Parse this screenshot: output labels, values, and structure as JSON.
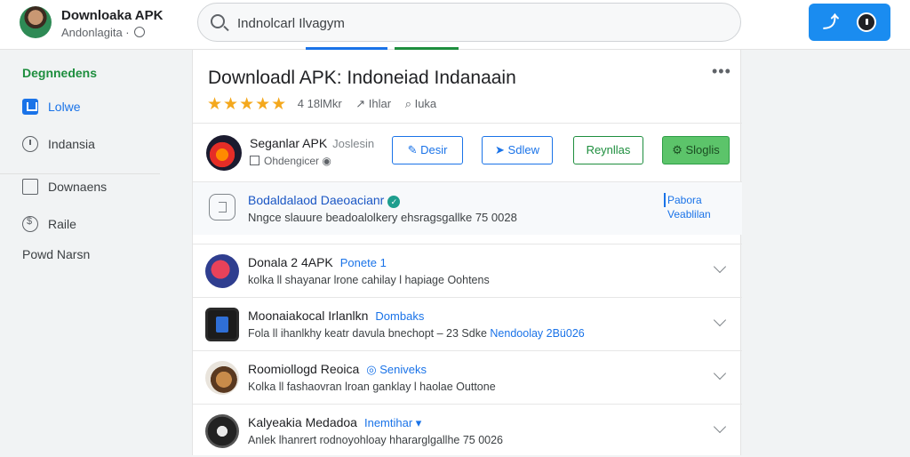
{
  "header": {
    "brand_title": "Downloaka APK",
    "brand_subtitle": "Andonlagita ·",
    "search_value": "Indnolcarl Ilvagym",
    "action_icon_1": "arrow-icon",
    "action_icon_2": "power-icon"
  },
  "sidebar": {
    "heading": "Degnnedens",
    "items": [
      {
        "label": "Lolwe",
        "icon": "home-icon",
        "active": true
      },
      {
        "label": "Indansia",
        "icon": "clock-icon",
        "active": false
      },
      {
        "label": "Downaens",
        "icon": "folder-icon",
        "active": false
      },
      {
        "label": "Raile",
        "icon": "rate-icon",
        "active": false
      }
    ],
    "footer": "Powd Narsn"
  },
  "main": {
    "title": "Downloadl APK: Indoneiad Indanaain",
    "rating_stars": "★★★★★",
    "rating_count": "4 18lMkr",
    "rating_share": "↗ Ihlar",
    "rating_comment": "⌕ Iuka",
    "developer": {
      "name": "Seganlar APK",
      "name_sub": "Joslesin",
      "subtitle": "Ohdengicer",
      "buttons": [
        "Desir",
        "Sdlew",
        "Reynllas",
        "Sloglis"
      ]
    },
    "info": {
      "title": "Bodaldalaod Daeoacianr",
      "desc": "Nngce slauure beadoalolkery ehsragsgallke 75 0028",
      "side_line1": "Pabora",
      "side_line2": "Veablilan"
    },
    "apps": [
      {
        "title": "Donala",
        "title_extra": "2 4APK",
        "tag": "Ponete 1",
        "desc": "kolka ll shayanar lrone cahilay l hapiage Oohtens",
        "desc_hl": ""
      },
      {
        "title": "Moonaiakocal Irlanlkn",
        "title_extra": "",
        "tag": "Dombaks",
        "desc": "Fola ll ihanlkhy keatr davula bnechopt – 23 Sdke",
        "desc_hl": "Nendoolay 2Bü026"
      },
      {
        "title": "Roomiollogd Reoica",
        "title_extra": "",
        "tag": "◎ Seniveks",
        "desc": "Kolka ll fashaovran lroan ganklay l haolae Outtone",
        "desc_hl": ""
      },
      {
        "title": "Kalyeakia Medadoa",
        "title_extra": "",
        "tag": "Inemtihar ▾",
        "desc": "Anlek lhanrert rodnoyohloay hhararglgallhe 75 0026",
        "desc_hl": ""
      }
    ]
  },
  "colors": {
    "accent_blue": "#1a73e8",
    "accent_green": "#1e8e3e",
    "star": "#f4a81d"
  }
}
